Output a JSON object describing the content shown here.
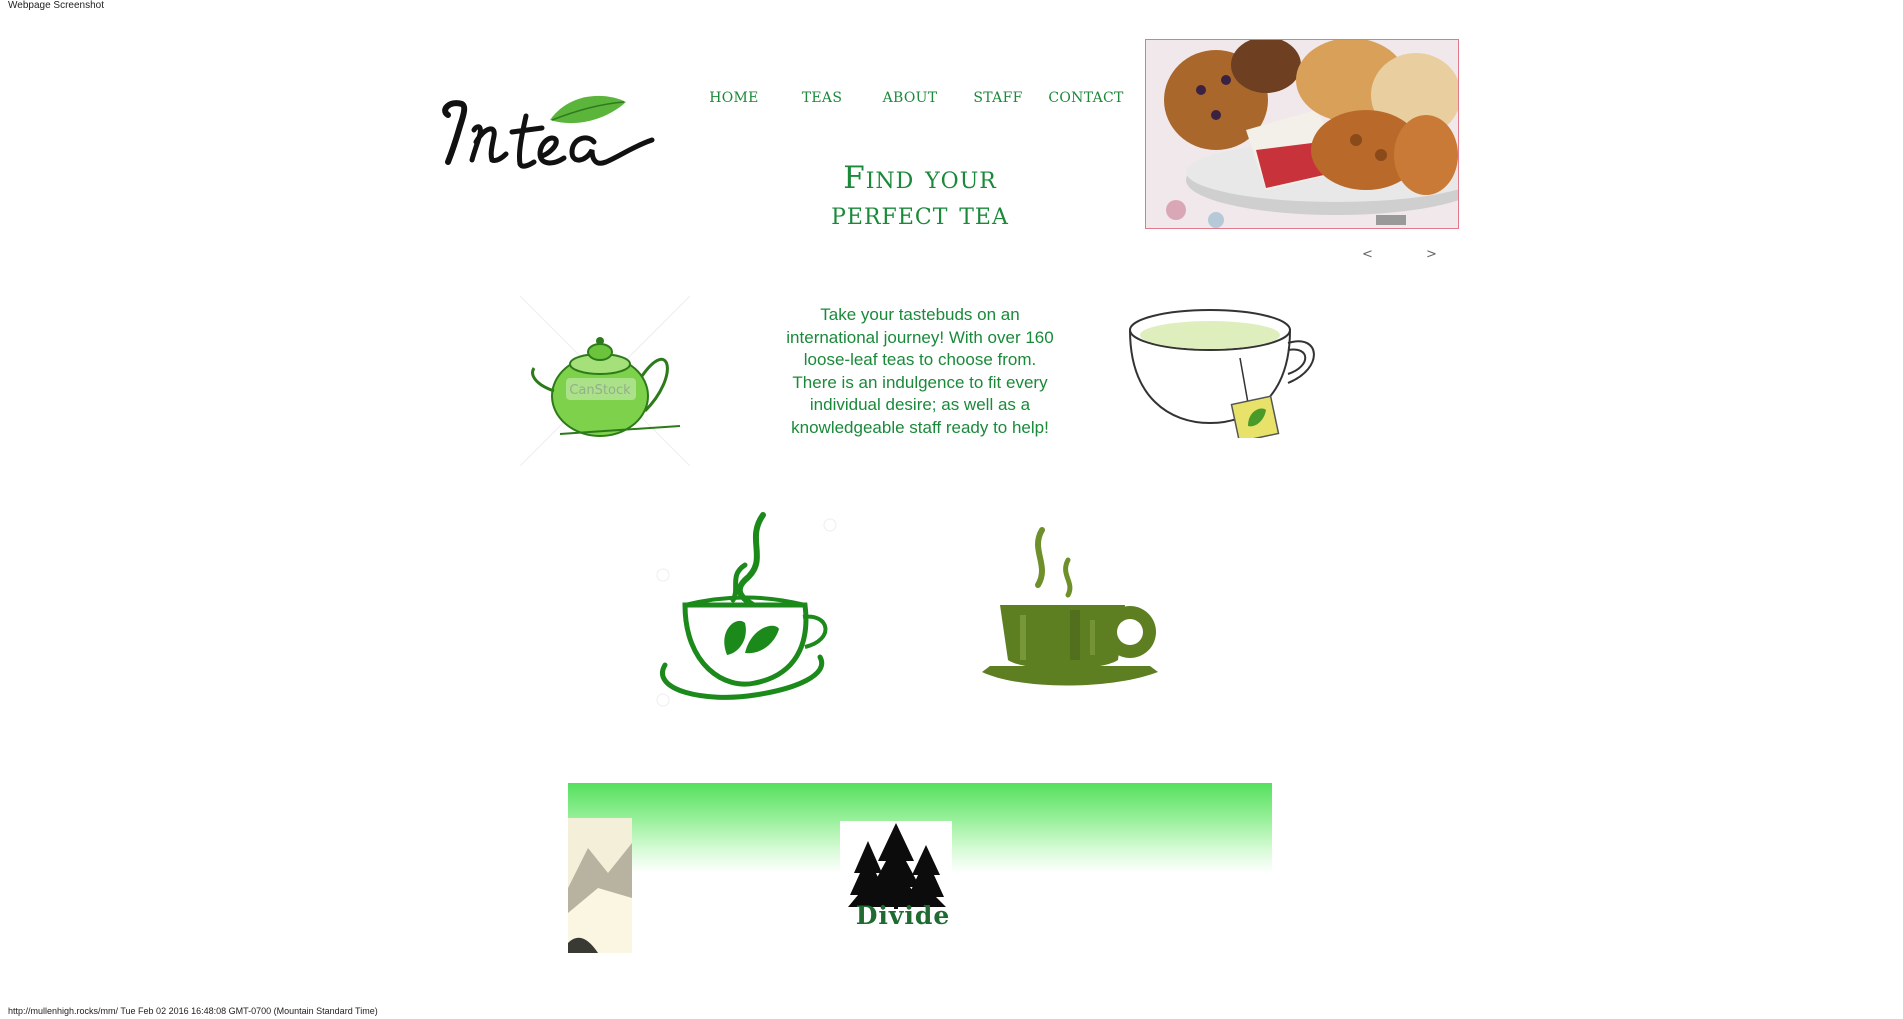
{
  "screenshot": {
    "header_label": "Webpage Screenshot",
    "footer_label": "http://mullenhigh.rocks/mm/ Tue Feb 02 2016 16:48:08 GMT-0700 (Mountain Standard Time)"
  },
  "brand": {
    "logo_icon": "intea-logo",
    "logo_text": "In tea"
  },
  "nav": {
    "items": [
      {
        "label": "HOME"
      },
      {
        "label": "TEAS"
      },
      {
        "label": "ABOUT"
      },
      {
        "label": "STAFF"
      },
      {
        "label": "CONTACT"
      }
    ]
  },
  "slider": {
    "image_icon": "pastries-photo",
    "prev_label": "<",
    "next_label": ">"
  },
  "hero": {
    "heading_line1": "Find your",
    "heading_line2": "perfect tea",
    "intro": "Take your tastebuds on an international journey! With over 160 loose-leaf teas to choose from. There is an indulgence to fit every individual desire; as well as a knowledgeable staff ready to help!"
  },
  "gallery": {
    "teapot_icon": "green-teapot-icon",
    "teapot_watermark": "CanStock",
    "cup_sketch_icon": "tea-cup-with-bag-icon",
    "cup_leaf_icon": "steaming-cup-leaf-icon",
    "cup_grunge_icon": "steaming-mug-icon"
  },
  "banner": {
    "mountain_icon": "mountain-photo",
    "divide_icon": "pine-trees-icon",
    "divide_text": "Divide"
  },
  "colors": {
    "brand_green": "#1a8a3a",
    "banner_green": "#55e05e",
    "divide_green": "#1f6b32"
  }
}
